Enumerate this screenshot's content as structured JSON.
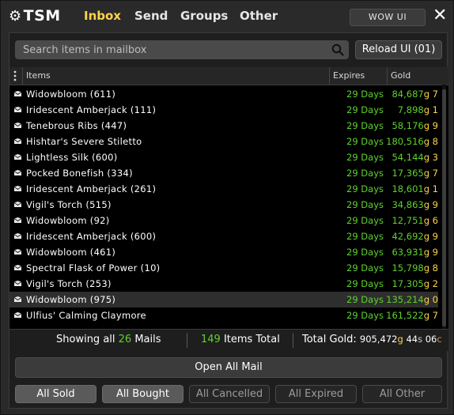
{
  "header": {
    "logo": "TSM",
    "tabs": [
      {
        "label": "Inbox",
        "active": true
      },
      {
        "label": "Send",
        "active": false
      },
      {
        "label": "Groups",
        "active": false
      },
      {
        "label": "Other",
        "active": false
      }
    ],
    "wow_ui_button": "WOW UI",
    "close_glyph": "✕"
  },
  "search": {
    "placeholder": "Search items in mailbox"
  },
  "reload_button": "Reload UI (01)",
  "table": {
    "columns": {
      "items": "Items",
      "expires": "Expires",
      "gold": "Gold"
    },
    "rows": [
      {
        "name": "Widowbloom (611)",
        "expires": "29 Days",
        "gold_n": "84,687",
        "gold_u": "g 7"
      },
      {
        "name": "Iridescent Amberjack (111)",
        "expires": "29 Days",
        "gold_n": "7,898",
        "gold_u": "g 1"
      },
      {
        "name": "Tenebrous Ribs (447)",
        "expires": "29 Days",
        "gold_n": "58,176",
        "gold_u": "g 9"
      },
      {
        "name": "Hishtar's Severe Stiletto",
        "expires": "29 Days",
        "gold_n": "180,516",
        "gold_u": "g 8"
      },
      {
        "name": "Lightless Silk (600)",
        "expires": "29 Days",
        "gold_n": "54,144",
        "gold_u": "g 3"
      },
      {
        "name": "Pocked Bonefish (334)",
        "expires": "29 Days",
        "gold_n": "17,365",
        "gold_u": "g 7"
      },
      {
        "name": "Iridescent Amberjack (261)",
        "expires": "29 Days",
        "gold_n": "18,601",
        "gold_u": "g 1"
      },
      {
        "name": "Vigil's Torch (515)",
        "expires": "29 Days",
        "gold_n": "34,863",
        "gold_u": "g 9"
      },
      {
        "name": "Widowbloom (92)",
        "expires": "29 Days",
        "gold_n": "12,751",
        "gold_u": "g 6"
      },
      {
        "name": "Iridescent Amberjack (600)",
        "expires": "29 Days",
        "gold_n": "42,692",
        "gold_u": "g 9"
      },
      {
        "name": "Widowbloom (461)",
        "expires": "29 Days",
        "gold_n": "63,931",
        "gold_u": "g 9"
      },
      {
        "name": "Spectral Flask of Power (10)",
        "expires": "29 Days",
        "gold_n": "15,798",
        "gold_u": "g 8"
      },
      {
        "name": "Vigil's Torch (253)",
        "expires": "29 Days",
        "gold_n": "17,305",
        "gold_u": "g 2"
      },
      {
        "name": "Widowbloom (975)",
        "expires": "29 Days",
        "gold_n": "135,214",
        "gold_u": "g 0",
        "selected": true
      },
      {
        "name": "Ulfius' Calming Claymore",
        "expires": "29 Days",
        "gold_n": "161,522",
        "gold_u": "g 7"
      }
    ]
  },
  "summary": {
    "showing_prefix": "Showing all",
    "mail_count": "26",
    "mails_suffix": "Mails",
    "items_count": "149",
    "items_suffix": "Items Total",
    "gold_label": "Total Gold:",
    "gold_value": "905,472",
    "gold_g": "g",
    "gold_s": "44",
    "gold_s_unit": "s",
    "gold_c": "06",
    "gold_c_unit": "c"
  },
  "open_all_button": "Open All Mail",
  "filters": [
    {
      "label": "All Sold",
      "enabled": true
    },
    {
      "label": "All Bought",
      "enabled": true
    },
    {
      "label": "All Cancelled",
      "enabled": false
    },
    {
      "label": "All Expired",
      "enabled": false
    },
    {
      "label": "All Other",
      "enabled": false
    }
  ],
  "colors": {
    "accent_gold": "#ffd34a",
    "positive_green": "#5fd12e",
    "background": "#2a2a2a"
  }
}
